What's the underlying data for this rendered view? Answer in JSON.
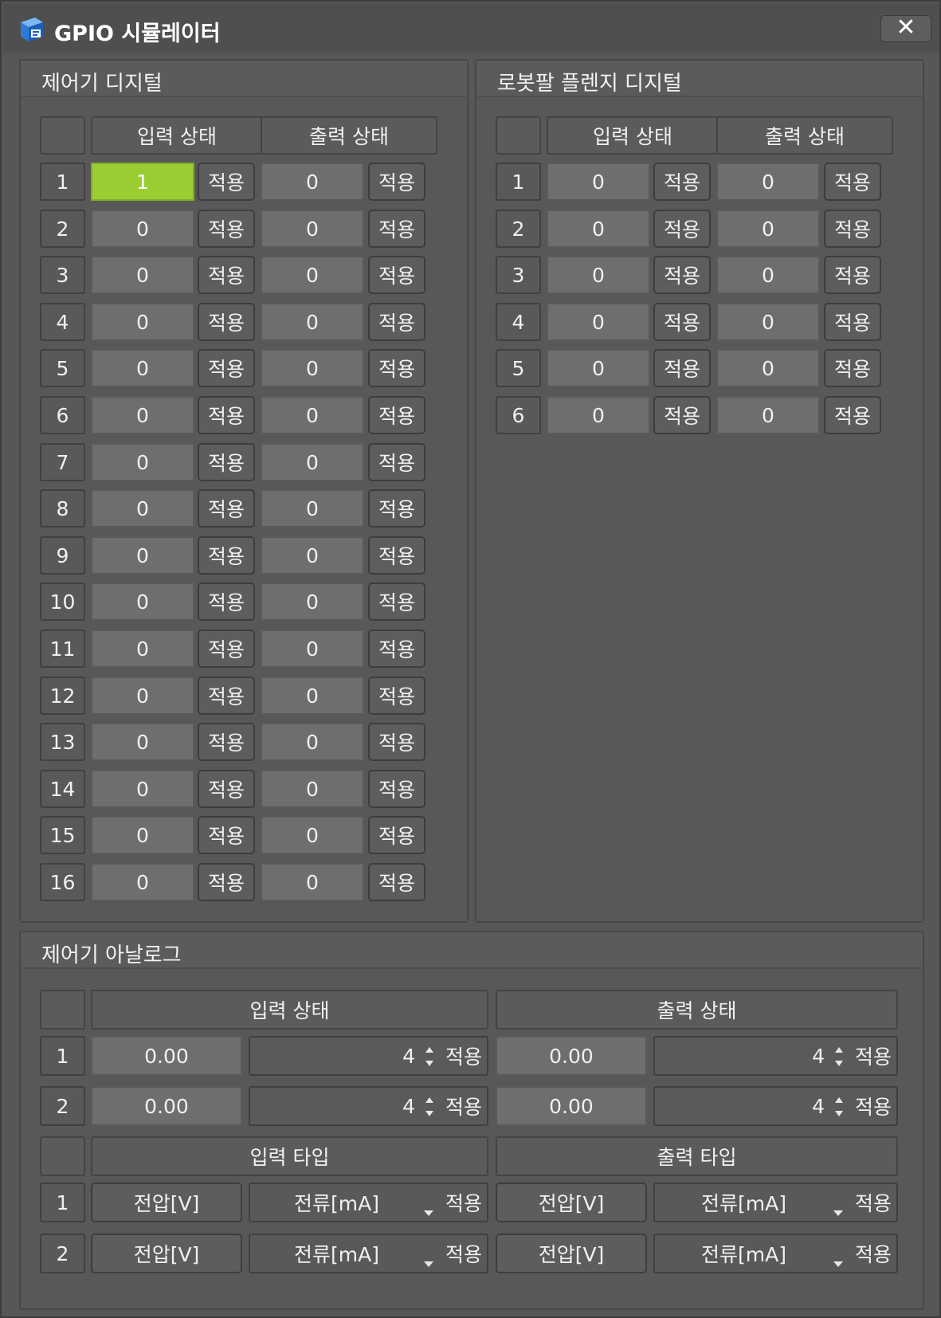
{
  "window": {
    "title": "GPIO 시뮬레이터",
    "close_label": "✕"
  },
  "controller_digital": {
    "title": "제어기 디지털",
    "input_header": "입력 상태",
    "output_header": "출력 상태",
    "apply_label": "적용",
    "rows": [
      {
        "idx": "1",
        "in": "1",
        "out": "0"
      },
      {
        "idx": "2",
        "in": "0",
        "out": "0"
      },
      {
        "idx": "3",
        "in": "0",
        "out": "0"
      },
      {
        "idx": "4",
        "in": "0",
        "out": "0"
      },
      {
        "idx": "5",
        "in": "0",
        "out": "0"
      },
      {
        "idx": "6",
        "in": "0",
        "out": "0"
      },
      {
        "idx": "7",
        "in": "0",
        "out": "0"
      },
      {
        "idx": "8",
        "in": "0",
        "out": "0"
      },
      {
        "idx": "9",
        "in": "0",
        "out": "0"
      },
      {
        "idx": "10",
        "in": "0",
        "out": "0"
      },
      {
        "idx": "11",
        "in": "0",
        "out": "0"
      },
      {
        "idx": "12",
        "in": "0",
        "out": "0"
      },
      {
        "idx": "13",
        "in": "0",
        "out": "0"
      },
      {
        "idx": "14",
        "in": "0",
        "out": "0"
      },
      {
        "idx": "15",
        "in": "0",
        "out": "0"
      },
      {
        "idx": "16",
        "in": "0",
        "out": "0"
      }
    ]
  },
  "flange_digital": {
    "title": "로봇팔 플렌지 디지털",
    "input_header": "입력 상태",
    "output_header": "출력 상태",
    "apply_label": "적용",
    "rows": [
      {
        "idx": "1",
        "in": "0",
        "out": "0"
      },
      {
        "idx": "2",
        "in": "0",
        "out": "0"
      },
      {
        "idx": "3",
        "in": "0",
        "out": "0"
      },
      {
        "idx": "4",
        "in": "0",
        "out": "0"
      },
      {
        "idx": "5",
        "in": "0",
        "out": "0"
      },
      {
        "idx": "6",
        "in": "0",
        "out": "0"
      }
    ]
  },
  "controller_analog": {
    "title": "제어기 아날로그",
    "input_state_header": "입력 상태",
    "output_state_header": "출력 상태",
    "input_type_header": "입력 타입",
    "output_type_header": "출력 타입",
    "apply_label": "적용",
    "state_rows": [
      {
        "idx": "1",
        "in_value": "0.00",
        "in_spin": "4",
        "out_value": "0.00",
        "out_spin": "4"
      },
      {
        "idx": "2",
        "in_value": "0.00",
        "in_spin": "4",
        "out_value": "0.00",
        "out_spin": "4"
      }
    ],
    "type_rows": [
      {
        "idx": "1",
        "in_type": "전압[V]",
        "in_combo": "전류[mA]",
        "out_type": "전압[V]",
        "out_combo": "전류[mA]"
      },
      {
        "idx": "2",
        "in_type": "전압[V]",
        "in_combo": "전류[mA]",
        "out_type": "전압[V]",
        "out_combo": "전류[mA]"
      }
    ]
  },
  "colors": {
    "active_input": "#9acd32",
    "panel_bg": "#585858",
    "field_bg": "#6e6e6e"
  }
}
